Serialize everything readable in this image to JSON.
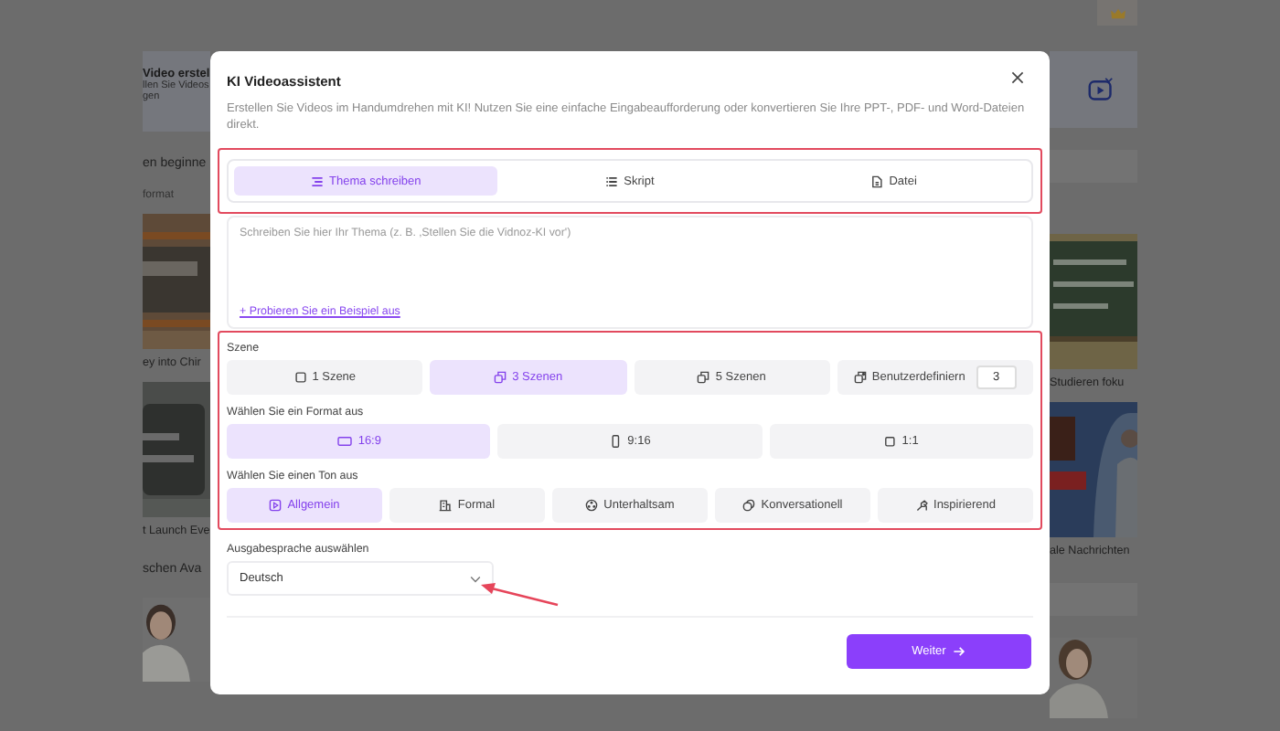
{
  "background": {
    "banner": {
      "title": "Video erstel",
      "lines": [
        "llen Sie Videos",
        "gen"
      ]
    },
    "section_title": "en beginne",
    "filter": "format",
    "left_captions": [
      "ey into Chir",
      "t Launch Eve"
    ],
    "section_title_2": "schen Ava",
    "right_captions": [
      "Studieren foku",
      "ale Nachrichten"
    ]
  },
  "dialog": {
    "title": "KI Videoassistent",
    "description": "Erstellen Sie Videos im Handumdrehen mit KI! Nutzen Sie eine einfache Eingabeaufforderung oder konvertieren Sie Ihre PPT-, PDF- und Word-Dateien direkt.",
    "tabs": [
      {
        "label": "Thema schreiben",
        "selected": true
      },
      {
        "label": "Skript",
        "selected": false
      },
      {
        "label": "Datei",
        "selected": false
      }
    ],
    "topic": {
      "placeholder": "Schreiben Sie hier Ihr Thema (z. B. ‚Stellen Sie die Vidnoz-KI vor')",
      "example_link": "+ Probieren Sie ein Beispiel aus"
    },
    "scene": {
      "label": "Szene",
      "options": [
        {
          "label": "1 Szene",
          "kind": "preset",
          "selected": false
        },
        {
          "label": "3 Szenen",
          "kind": "preset",
          "selected": true
        },
        {
          "label": "5 Szenen",
          "kind": "preset",
          "selected": false
        },
        {
          "label": "Benutzerdefiniern",
          "kind": "custom",
          "value": "3",
          "selected": false
        }
      ]
    },
    "format": {
      "label": "Wählen Sie ein Format aus",
      "options": [
        {
          "label": "16:9",
          "selected": true
        },
        {
          "label": "9:16",
          "selected": false
        },
        {
          "label": "1:1",
          "selected": false
        }
      ]
    },
    "tone": {
      "label": "Wählen Sie einen Ton aus",
      "options": [
        {
          "label": "Allgemein",
          "selected": true
        },
        {
          "label": "Formal",
          "selected": false
        },
        {
          "label": "Unterhaltsam",
          "selected": false
        },
        {
          "label": "Konversationell",
          "selected": false
        },
        {
          "label": "Inspirierend",
          "selected": false
        }
      ]
    },
    "language": {
      "label": "Ausgabesprache auswählen",
      "value": "Deutsch"
    },
    "next_button": "Weiter"
  }
}
